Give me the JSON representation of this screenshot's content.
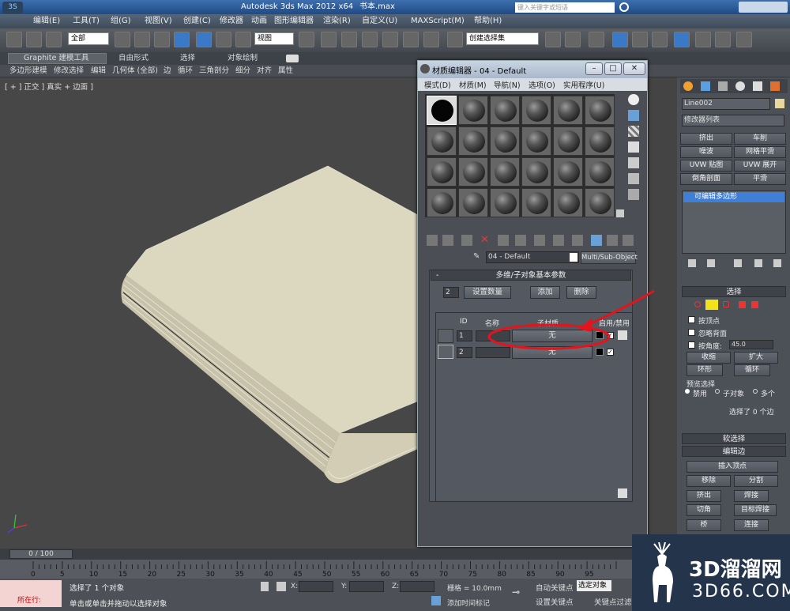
{
  "app": {
    "title": "Autodesk 3ds Max  2012 x64",
    "file": "书本.max",
    "search_placeholder": "键入关键字或短语"
  },
  "menu": [
    "编辑(E)",
    "工具(T)",
    "组(G)",
    "视图(V)",
    "创建(C)",
    "修改器",
    "动画",
    "图形编辑器",
    "渲染(R)",
    "自定义(U)",
    "MAXScript(M)",
    "帮助(H)"
  ],
  "toolbar": {
    "selection_filter": "全部",
    "ref_coord": "视图",
    "named_selection": "创建选择集"
  },
  "ribbon": {
    "tabs": [
      "Graphite 建模工具",
      "自由形式",
      "选择",
      "对象绘制"
    ],
    "sub": [
      "多边形建模",
      "修改选择",
      "编辑",
      "几何体 (全部)",
      "边",
      "循环",
      "三角剖分",
      "细分",
      "对齐",
      "属性"
    ]
  },
  "viewport": {
    "label": "[ + ] 正交 ] 真实 + 边面 ]"
  },
  "material_editor": {
    "title": "材质编辑器 - 04 - Default",
    "menu": [
      "模式(D)",
      "材质(M)",
      "导航(N)",
      "选项(O)",
      "实用程序(U)"
    ],
    "material_name": "04 - Default",
    "material_type": "Multi/Sub-Object",
    "rollout_title": "多维/子对象基本参数",
    "count": "2",
    "set_count": "设置数量",
    "add": "添加",
    "delete": "删除",
    "columns": [
      "ID",
      "名称",
      "子材质",
      "启用/禁用"
    ],
    "rows": [
      {
        "id": "1",
        "name": "",
        "sub": "无"
      },
      {
        "id": "2",
        "name": "",
        "sub": "无"
      }
    ]
  },
  "command_panel": {
    "object_name": "Line002",
    "modifier_list": "修改器列表",
    "mod_buttons": [
      "挤出",
      "车削",
      "噪波",
      "网格平滑",
      "UVW 贴图",
      "UVW 展开",
      "倒角剖面",
      "平滑"
    ],
    "stack_item": "可编辑多边形",
    "select_header": "选择",
    "by_vertex": "按顶点",
    "ignore_back": "忽略背面",
    "by_angle": "按角度:",
    "angle_value": "45.0",
    "shrink": "收缩",
    "grow": "扩大",
    "ring": "环形",
    "loop": "循环",
    "preview": "预览选择",
    "disabled": "禁用",
    "subobj": "子对象",
    "multi": "多个",
    "selected_info": "选择了 0 个边",
    "soft_select": "软选择",
    "edit_edges": "编辑边",
    "insert_vertex": "插入顶点",
    "remove": "移除",
    "split": "分割",
    "extrude": "挤出",
    "weld": "焊接",
    "chamfer": "切角",
    "target_weld": "目标焊接",
    "bridge": "桥",
    "connect": "连接"
  },
  "timeline": {
    "frame": "0 / 100",
    "ticks": [
      "0",
      "5",
      "10",
      "15",
      "20",
      "25",
      "30",
      "35",
      "40",
      "45",
      "50",
      "55",
      "60",
      "65",
      "70",
      "75",
      "80",
      "85",
      "90",
      "95"
    ]
  },
  "status": {
    "selected": "选择了 1 个对象",
    "hint": "单击或单击并拖动以选择对象",
    "script_label": "所在行:",
    "x": "X:",
    "y": "Y:",
    "z": "Z:",
    "grid": "栅格 = 10.0mm",
    "auto_key": "自动关键点",
    "selected_obj": "选定对象",
    "set_key": "设置关键点",
    "key_filter": "关键点过滤",
    "add_time_tag": "添加时间标记"
  },
  "watermark": {
    "brand": "3D溜溜网",
    "url": "3D66.COM"
  },
  "colors": {
    "annotation_red": "#e3141b",
    "book_cover": "#dcd7bf",
    "stack_select": "#3f7fd6"
  }
}
